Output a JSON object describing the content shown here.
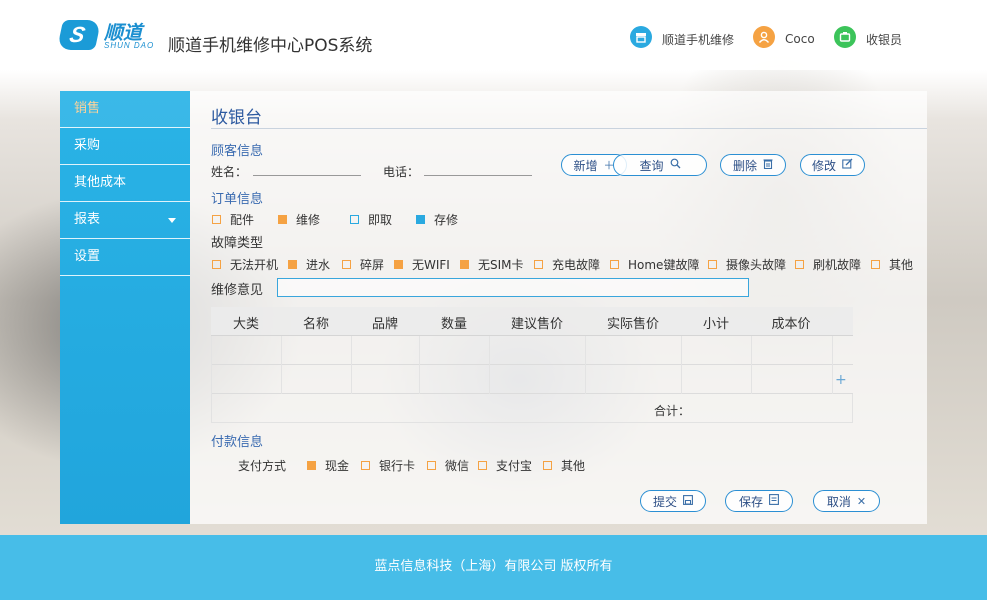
{
  "header": {
    "logo_cn": "顺道",
    "logo_en": "SHUN DAO",
    "app_title": "顺道手机维修中心POS系统",
    "shop": {
      "label": "顺道手机维修",
      "icon": "store-icon"
    },
    "user": {
      "label": "Coco",
      "icon": "user-icon"
    },
    "role": {
      "label": "收银员",
      "icon": "cashier-icon"
    }
  },
  "sidebar": {
    "items": [
      {
        "label": "销售",
        "active": true
      },
      {
        "label": "采购",
        "active": false
      },
      {
        "label": "其他成本",
        "active": false
      },
      {
        "label": "报表",
        "active": false,
        "has_dropdown": true
      },
      {
        "label": "设置",
        "active": false
      }
    ]
  },
  "main": {
    "title": "收银台",
    "customer": {
      "section": "顾客信息",
      "name_label": "姓名：",
      "name_value": "",
      "phone_label": "电话：",
      "phone_value": ""
    },
    "actions": [
      {
        "label": "新增",
        "icon": "plus-icon"
      },
      {
        "label": "查询",
        "icon": "search-icon"
      },
      {
        "label": "删除",
        "icon": "trash-icon"
      },
      {
        "label": "修改",
        "icon": "edit-icon"
      }
    ],
    "order": {
      "section": "订单信息",
      "options": [
        {
          "label": "配件",
          "style": "orange-empty"
        },
        {
          "label": "维修",
          "style": "orange-fill"
        },
        {
          "label": "即取",
          "style": "blue-empty"
        },
        {
          "label": "存修",
          "style": "blue-fill"
        }
      ]
    },
    "fault": {
      "section": "故障类型",
      "options": [
        {
          "label": "无法开机",
          "checked": false
        },
        {
          "label": "进水",
          "checked": true
        },
        {
          "label": "碎屏",
          "checked": false
        },
        {
          "label": "无WIFI",
          "checked": true
        },
        {
          "label": "无SIM卡",
          "checked": true
        },
        {
          "label": "充电故障",
          "checked": false
        },
        {
          "label": "Home键故障",
          "checked": false
        },
        {
          "label": "摄像头故障",
          "checked": false
        },
        {
          "label": "刷机故障",
          "checked": false
        },
        {
          "label": "其他",
          "checked": false
        }
      ]
    },
    "advice": {
      "label": "维修意见",
      "value": ""
    },
    "table": {
      "columns": [
        "大类",
        "名称",
        "品牌",
        "数量",
        "建议售价",
        "实际售价",
        "小计",
        "成本价"
      ],
      "add_symbol": "+",
      "total_label": "合计："
    },
    "payment": {
      "section": "付款信息",
      "method_label": "支付方式",
      "options": [
        {
          "label": "现金",
          "checked": true
        },
        {
          "label": "银行卡",
          "checked": false
        },
        {
          "label": "微信",
          "checked": false
        },
        {
          "label": "支付宝",
          "checked": false
        },
        {
          "label": "其他",
          "checked": false
        }
      ]
    },
    "buttons": [
      {
        "label": "提交",
        "icon": "save-disk-icon"
      },
      {
        "label": "保存",
        "icon": "document-icon"
      },
      {
        "label": "取消",
        "icon": "close-icon"
      }
    ]
  },
  "footer": {
    "copyright": "蓝点信息科技（上海）有限公司  版权所有"
  },
  "colors": {
    "accent": "#2ab3e6",
    "orange": "#f5a243",
    "footer": "#47bde8",
    "title_blue": "#2d5aa0"
  }
}
